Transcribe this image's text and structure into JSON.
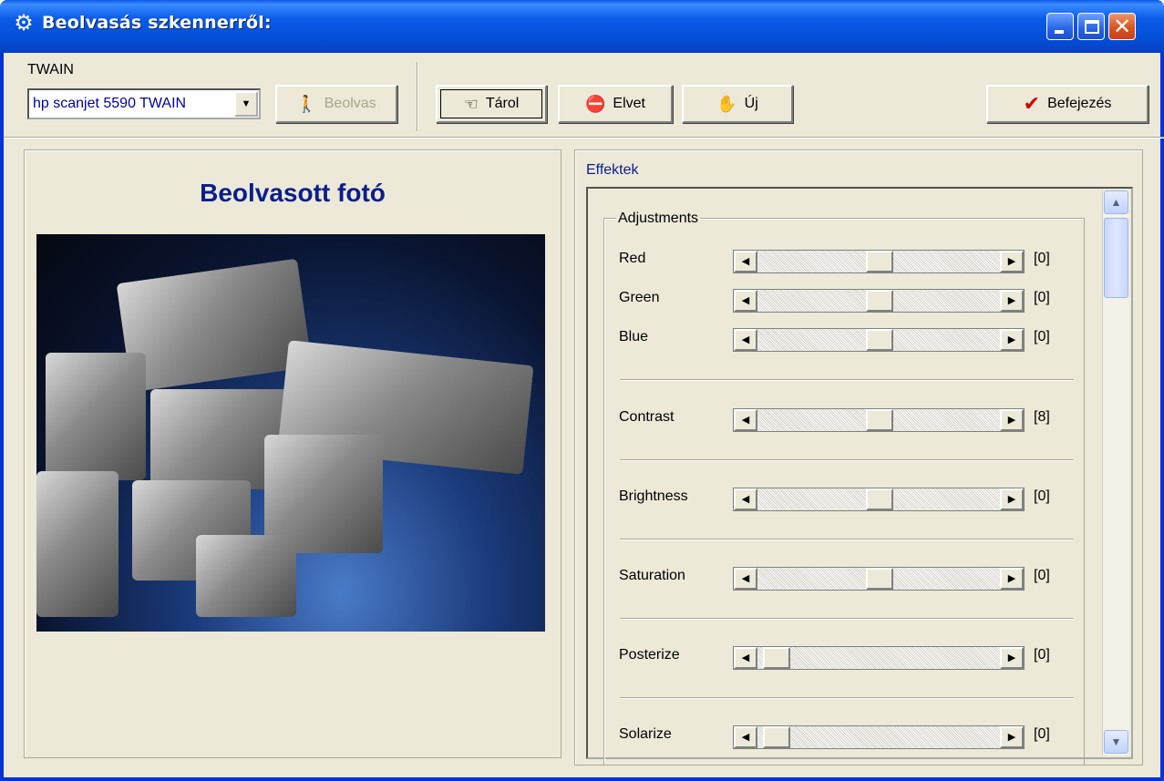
{
  "window": {
    "title": "Beolvasás szkennerről:",
    "close_glyph": "✕"
  },
  "toolbar": {
    "twain_label": "TWAIN",
    "scanner_select": "hp scanjet 5590 TWAIN",
    "scan_button": "Beolvas",
    "store_button": "Tárol",
    "discard_button": "Elvet",
    "new_button": "Új",
    "finish_button": "Befejezés"
  },
  "left_panel": {
    "title": "Beolvasott fotó"
  },
  "right_panel": {
    "section_label": "Effektek",
    "group_label": "Adjustments",
    "sliders": [
      {
        "label": "Red",
        "value": "[0]",
        "level": 0.5
      },
      {
        "label": "Green",
        "value": "[0]",
        "level": 0.5
      },
      {
        "label": "Blue",
        "value": "[0]",
        "level": 0.5
      },
      {
        "label": "Contrast",
        "value": "[8]",
        "level": 0.5
      },
      {
        "label": "Brightness",
        "value": "[0]",
        "level": 0.5
      },
      {
        "label": "Saturation",
        "value": "[0]",
        "level": 0.5
      },
      {
        "label": "Posterize",
        "value": "[0]",
        "level": 0.0
      },
      {
        "label": "Solarize",
        "value": "[0]",
        "level": 0.0
      }
    ]
  },
  "colors": {
    "title_bar": "#0550d8",
    "photo_title": "#0a1e8c",
    "finish_check": "#d40000",
    "discard_icon": "#d40000"
  },
  "icons": {
    "app": "gear-icon",
    "scan": "walking-figure-icon",
    "store": "pointing-hand-icon",
    "discard": "no-entry-icon",
    "new": "hand-icon",
    "finish": "checkmark-icon"
  }
}
